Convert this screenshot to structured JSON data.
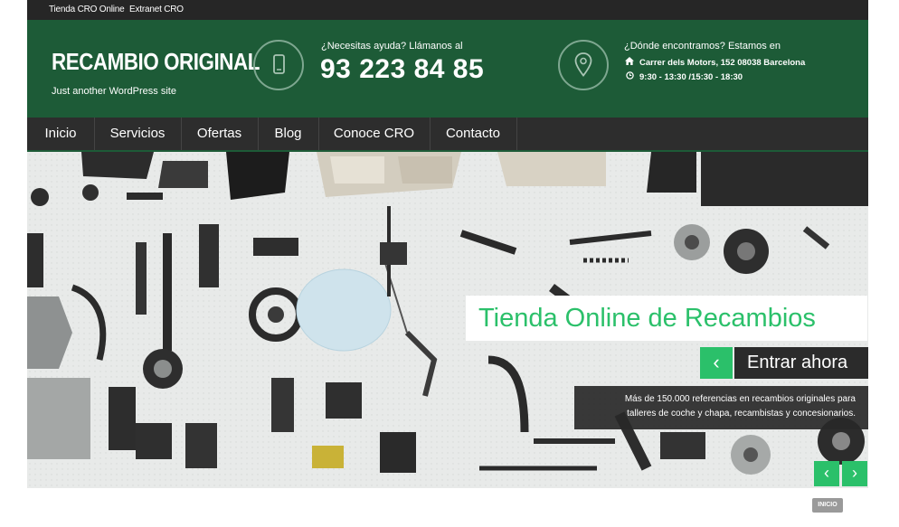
{
  "topbar": {
    "links": [
      "Tienda CRO Online",
      "Extranet CRO"
    ]
  },
  "header": {
    "site_title": "RECAMBIO ORIGINAL",
    "tagline": "Just another WordPress site",
    "help_question": "¿Necesitas ayuda? Llámanos al",
    "phone": "93 223 84 85",
    "location_question": "¿Dónde encontramos? Estamos en",
    "address": "Carrer dels Motors, 152 08038 Barcelona",
    "hours": "9:30 - 13:30 /15:30 - 18:30"
  },
  "nav": {
    "items": [
      "Inicio",
      "Servicios",
      "Ofertas",
      "Blog",
      "Conoce CRO",
      "Contacto"
    ]
  },
  "slide": {
    "title": "Tienda Online de Recambios",
    "cta_label": "Entrar ahora",
    "cta_icon": "‹",
    "description_line1": "Más de 150.000 referencias en recambios originales para",
    "description_line2": "talleres de coche y chapa, recambistas y concesionarios.",
    "prev_icon": "‹",
    "next_icon": "›"
  },
  "badge": "INICIO",
  "colors": {
    "brand_green": "#1d5b37",
    "accent_green": "#2bc06a",
    "dark": "#262626"
  },
  "icons": {
    "phone": "phone-icon",
    "location": "map-pin-icon",
    "home": "home-icon",
    "clock": "clock-icon"
  }
}
